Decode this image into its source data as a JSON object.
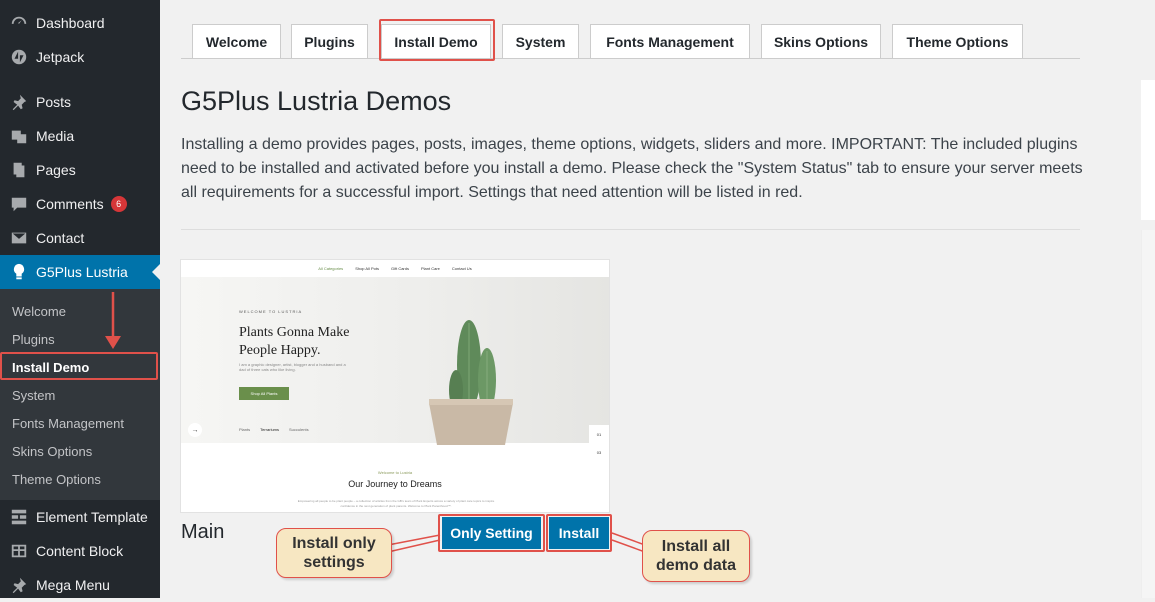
{
  "sidebar": {
    "items": [
      {
        "label": "Dashboard",
        "icon": "dashboard-icon"
      },
      {
        "label": "Jetpack",
        "icon": "jetpack-icon"
      },
      {
        "label": "Posts",
        "icon": "pin-icon"
      },
      {
        "label": "Media",
        "icon": "media-icon"
      },
      {
        "label": "Pages",
        "icon": "page-icon"
      },
      {
        "label": "Comments",
        "icon": "comment-icon",
        "badge": "6"
      },
      {
        "label": "Contact",
        "icon": "mail-icon"
      },
      {
        "label": "G5Plus Lustria",
        "icon": "bulb-icon",
        "active": true
      },
      {
        "label": "Element Template",
        "icon": "grid-icon"
      },
      {
        "label": "Content Block",
        "icon": "table-icon"
      },
      {
        "label": "Mega Menu",
        "icon": "pin-icon"
      }
    ],
    "submenu": [
      "Welcome",
      "Plugins",
      "Install Demo",
      "System",
      "Fonts Management",
      "Skins Options",
      "Theme Options"
    ],
    "submenu_current": "Install Demo"
  },
  "tabs": [
    "Welcome",
    "Plugins",
    "Install Demo",
    "System",
    "Fonts Management",
    "Skins Options",
    "Theme Options"
  ],
  "active_tab": "Install Demo",
  "page_title": "G5Plus Lustria Demos",
  "intro": "Installing a demo provides pages, posts, images, theme options, widgets, sliders and more. IMPORTANT: The included plugins need to be installed and activated before you install a demo. Please check the \"System Status\" tab to ensure your server meets all requirements for a successful import. Settings that need attention will be listed in red.",
  "demo": {
    "name": "Main",
    "preview": {
      "nav": [
        "All Categories",
        "Shop All Pots",
        "Gift Cards",
        "Plant Care",
        "Contact Us"
      ],
      "small_label": "WELCOME TO LUSTRIA",
      "headline_1": "Plants Gonna Make",
      "headline_2": "People Happy.",
      "sub_text": "I am a graphic designer, artist, blogger and a husband and a dad of three cats who like living.",
      "button": "Shop All Plants",
      "categories": [
        "Plants",
        "Terrariums",
        "Succulents"
      ],
      "side_1": "01",
      "side_2": "03",
      "welcome_small": "Welcome to Lustria",
      "journey_title": "Our Journey to Dreams",
      "body_text": "Empowering all people to be plant people – a collection of articles from the GB's team of Plant Experts across a variety of plant care topics to inspire confidence in the next generation of plant parents. Welcome to Plant Parenthood™."
    },
    "buttons": {
      "only_setting": "Only Setting",
      "install": "Install"
    }
  },
  "callouts": {
    "left": "Install only settings",
    "right": "Install all demo data"
  },
  "colors": {
    "sidebar": "#23282d",
    "active": "#0073aa",
    "highlight": "#e0514a",
    "callout_bg": "#f7e7c2"
  }
}
